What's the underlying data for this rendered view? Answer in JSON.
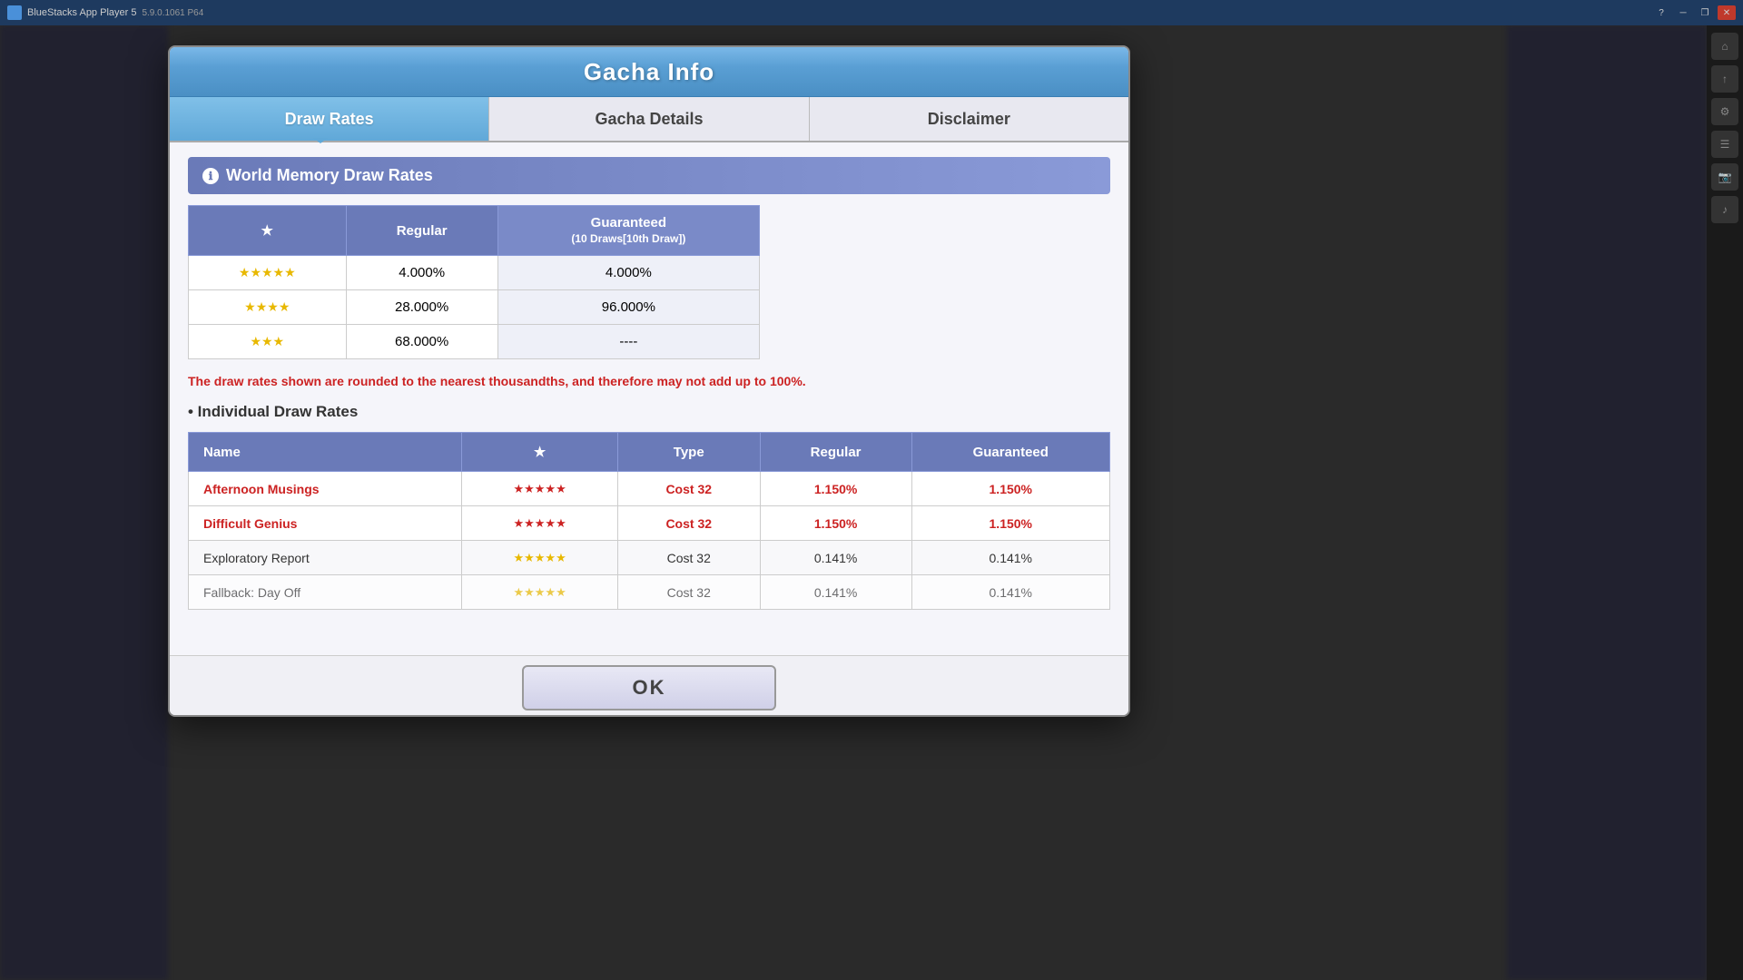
{
  "taskbar": {
    "title": "BlueStacks App Player 5",
    "version": "5.9.0.1061 P64",
    "controls": [
      "back",
      "home",
      "bookmark",
      "help",
      "minimize",
      "restore",
      "close"
    ]
  },
  "dialog": {
    "title": "Gacha Info",
    "tabs": [
      {
        "label": "Draw Rates",
        "active": true
      },
      {
        "label": "Gacha Details",
        "active": false
      },
      {
        "label": "Disclaimer",
        "active": false
      }
    ],
    "section_title": "World Memory Draw Rates",
    "table_headers": {
      "star": "★",
      "regular": "Regular",
      "guaranteed": "Guaranteed",
      "guaranteed_sub": "(10 Draws[10th Draw])"
    },
    "rates_rows": [
      {
        "stars": "★★★★★",
        "regular": "4.000%",
        "guaranteed": "4.000%"
      },
      {
        "stars": "★★★★",
        "regular": "28.000%",
        "guaranteed": "96.000%"
      },
      {
        "stars": "★★★",
        "regular": "68.000%",
        "guaranteed": "----"
      }
    ],
    "warning_text": "The draw rates shown are rounded to the nearest thousandths, and therefore may not add up to 100%.",
    "individual_section_label": "• Individual Draw Rates",
    "individual_headers": {
      "name": "Name",
      "star": "★",
      "type": "Type",
      "regular": "Regular",
      "guaranteed": "Guaranteed"
    },
    "individual_rows": [
      {
        "name": "Afternoon Musings",
        "stars": "★★★★★",
        "type": "Cost 32",
        "regular": "1.150%",
        "guaranteed": "1.150%",
        "highlight": true
      },
      {
        "name": "Difficult Genius",
        "stars": "★★★★★",
        "type": "Cost 32",
        "regular": "1.150%",
        "guaranteed": "1.150%",
        "highlight": true
      },
      {
        "name": "Exploratory Report",
        "stars": "★★★★★",
        "type": "Cost 32",
        "regular": "0.141%",
        "guaranteed": "0.141%",
        "highlight": false
      },
      {
        "name": "Fallback: Day Off",
        "stars": "★★★★★",
        "type": "Cost 32",
        "regular": "0.141%",
        "guaranteed": "0.141%",
        "highlight": false,
        "partial": true
      }
    ],
    "ok_label": "OK"
  }
}
